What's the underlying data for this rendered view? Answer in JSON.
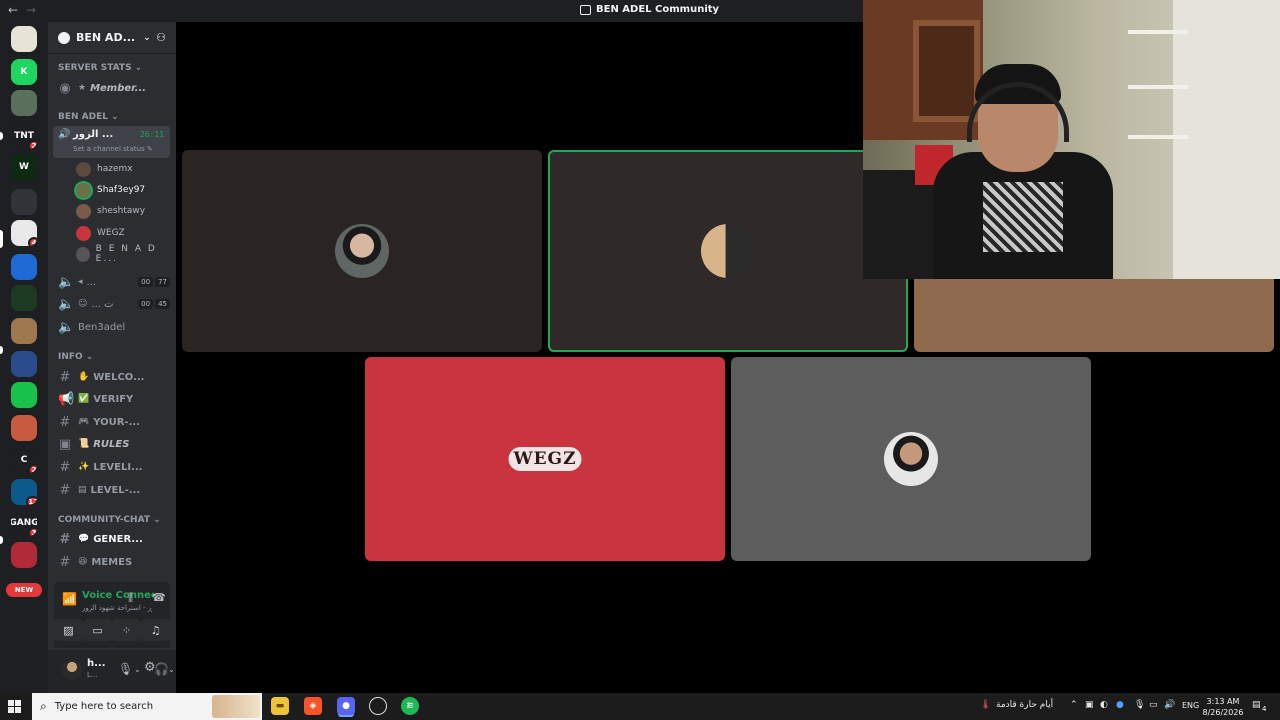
{
  "window": {
    "title": "BEN ADEL Community"
  },
  "server_rail": {
    "items": [
      {
        "label": "",
        "color": "#e7e3d6",
        "badge": ""
      },
      {
        "label": "K",
        "color": "#1ed760",
        "badge": ""
      },
      {
        "label": "",
        "color": "#5a6f5c",
        "badge": ""
      },
      {
        "label": "TNT",
        "color": "#1e1f22",
        "badge": "2"
      },
      {
        "label": "W",
        "color": "#0e2a12",
        "badge": ""
      },
      {
        "label": "",
        "color": "#5865f2",
        "badge": ""
      },
      {
        "label": "",
        "color": "#e8e8e8",
        "badge": "4"
      },
      {
        "label": "",
        "color": "#1e6bd6",
        "badge": ""
      },
      {
        "label": "",
        "color": "#1d3b22",
        "badge": ""
      },
      {
        "label": "",
        "color": "#a07850",
        "badge": ""
      },
      {
        "label": "",
        "color": "#2b4c8c",
        "badge": ""
      },
      {
        "label": "",
        "color": "#19c24a",
        "badge": ""
      },
      {
        "label": "",
        "color": "#c85a42",
        "badge": ""
      },
      {
        "label": "C",
        "color": "#1e1f22",
        "badge": "2"
      },
      {
        "label": "",
        "color": "#0c5a8a",
        "badge": "12"
      },
      {
        "label": "GANG",
        "color": "#1e1f22",
        "badge": "3"
      },
      {
        "label": "",
        "color": "#b02a3a",
        "badge": ""
      }
    ],
    "new_label": "NEW"
  },
  "sidebar": {
    "server_name": "BEN AD...",
    "categories": {
      "server_stats": "SERVER STATS",
      "ben_adel": "BEN ADEL",
      "info": "INFO",
      "community_chat": "COMMUNITY-CHAT"
    },
    "stats_channel": "Member...",
    "active_voice": {
      "name": "الزور ...",
      "timer": "26:11",
      "status_hint": "Set a channel status"
    },
    "voice_users": [
      "hazemx",
      "Shaf3ey97",
      "sheshtawy",
      "WEGZ",
      "B E N A D E..."
    ],
    "voice_channels": [
      {
        "name": "...",
        "counts": [
          "00",
          "77"
        ]
      },
      {
        "name": "... ت",
        "counts": [
          "00",
          "45"
        ]
      },
      {
        "name": "Ben3adel",
        "counts": []
      }
    ],
    "info_channels": [
      "WELCO...",
      "VERIFY",
      "YOUR-...",
      "RULES",
      "LEVELI...",
      "LEVEL-..."
    ],
    "chat_channels": [
      "GENER...",
      "MEMES"
    ]
  },
  "voice_panel": {
    "title": "Voice Connected",
    "subtitle": "غرفة الزور - استراحة شهود الزور"
  },
  "user_bar": {
    "name": "h...",
    "status": "L..."
  },
  "taskbar": {
    "search_placeholder": "Type here to search",
    "weather_text": "أيام حارة قادمة",
    "lang": "ENG",
    "time": "3:13 AM",
    "date": "8/26/2026",
    "notif_count": "4"
  }
}
